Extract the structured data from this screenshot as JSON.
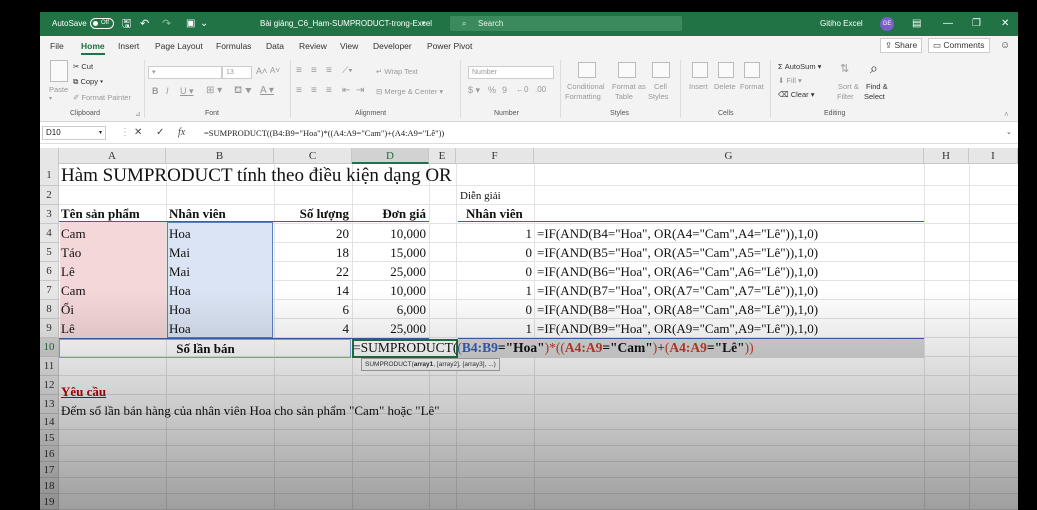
{
  "titlebar": {
    "autosave_label": "AutoSave",
    "autosave_state": "Off",
    "doc_title": "Bài giảng_C6_Ham-SUMPRODUCT-trong-Excel",
    "search_placeholder": "Search",
    "user_name": "Gitiho Excel",
    "user_initials": "GE"
  },
  "tabs": [
    "File",
    "Home",
    "Insert",
    "Page Layout",
    "Formulas",
    "Data",
    "Review",
    "View",
    "Developer",
    "Power Pivot"
  ],
  "share_label": "Share",
  "comments_label": "Comments",
  "ribbon": {
    "clipboard": {
      "paste": "Paste",
      "cut": "Cut",
      "copy": "Copy",
      "format_painter": "Format Painter",
      "group": "Clipboard"
    },
    "font": {
      "size": "13",
      "group": "Font"
    },
    "alignment": {
      "wrap": "Wrap Text",
      "merge": "Merge & Center",
      "group": "Alignment"
    },
    "number": {
      "format": "Number",
      "group": "Number"
    },
    "styles": {
      "cond": "Conditional",
      "cond2": "Formatting",
      "fmt_table": "Format as",
      "fmt_table2": "Table",
      "cell_styles": "Cell",
      "cell_styles2": "Styles",
      "group": "Styles"
    },
    "cells": {
      "insert": "Insert",
      "delete": "Delete",
      "format": "Format",
      "group": "Cells"
    },
    "editing": {
      "autosum": "AutoSum",
      "fill": "Fill",
      "clear": "Clear",
      "sort": "Sort &",
      "sort2": "Filter",
      "find": "Find &",
      "find2": "Select",
      "group": "Editing"
    }
  },
  "formula_bar": {
    "name_box": "D10",
    "formula": "=SUMPRODUCT((B4:B9=\"Hoa\")*((A4:A9=\"Cam\")+(A4:A9=\"Lê\"))"
  },
  "columns": [
    "A",
    "B",
    "C",
    "D",
    "E",
    "F",
    "G",
    "H",
    "I"
  ],
  "rows": [
    "1",
    "2",
    "3",
    "4",
    "5",
    "6",
    "7",
    "8",
    "9",
    "10",
    "11",
    "12",
    "13",
    "14",
    "15",
    "16",
    "17",
    "18",
    "19"
  ],
  "sheet": {
    "title": "Hàm SUMPRODUCT tính theo điều kiện dạng OR",
    "headers": {
      "product": "Tên sản phẩm",
      "staff": "Nhân viên",
      "qty": "Số lượng",
      "price": "Đơn giá"
    },
    "table": [
      {
        "product": "Cam",
        "staff": "Hoa",
        "qty": "20",
        "price": "10,000"
      },
      {
        "product": "Táo",
        "staff": "Mai",
        "qty": "18",
        "price": "15,000"
      },
      {
        "product": "Lê",
        "staff": "Mai",
        "qty": "22",
        "price": "25,000"
      },
      {
        "product": "Cam",
        "staff": "Hoa",
        "qty": "14",
        "price": "10,000"
      },
      {
        "product": "Ổi",
        "staff": "Hoa",
        "qty": "6",
        "price": "6,000"
      },
      {
        "product": "Lê",
        "staff": "Hoa",
        "qty": "4",
        "price": "25,000"
      }
    ],
    "total_label": "Số lần bán",
    "explain_title": "Diễn giải",
    "explain_header": "Nhân viên",
    "explain": [
      {
        "value": "1",
        "formula": "=IF(AND(B4=\"Hoa\", OR(A4=\"Cam\",A4=\"Lê\")),1,0)"
      },
      {
        "value": "0",
        "formula": "=IF(AND(B5=\"Hoa\", OR(A5=\"Cam\",A5=\"Lê\")),1,0)"
      },
      {
        "value": "0",
        "formula": "=IF(AND(B6=\"Hoa\", OR(A6=\"Cam\",A6=\"Lê\")),1,0)"
      },
      {
        "value": "1",
        "formula": "=IF(AND(B7=\"Hoa\", OR(A7=\"Cam\",A7=\"Lê\")),1,0)"
      },
      {
        "value": "0",
        "formula": "=IF(AND(B8=\"Hoa\", OR(A8=\"Cam\",A8=\"Lê\")),1,0)"
      },
      {
        "value": "1",
        "formula": "=IF(AND(B9=\"Hoa\", OR(A9=\"Cam\",A9=\"Lê\")),1,0)"
      }
    ],
    "editing": {
      "p1": "=SUMPRODUCT(",
      "p2": "(",
      "p3": "B4:B9",
      "p4": "=\"Hoa\"",
      "p5": ")*(",
      "p6": "(",
      "p7": "A4:A9",
      "p8": "=\"Cam\"",
      "p9": ")",
      "p10": "+",
      "p11": "(",
      "p12": "A4:A9",
      "p13": "=\"Lê\"",
      "p14": "))"
    },
    "hint": {
      "fn": "SUMPRODUCT(",
      "arg1": "array1",
      "rest": ", [array2], [array3], ...)"
    },
    "req_label": "Yêu cầu",
    "req_text": "Đếm số lần bán hàng của nhân viên Hoa cho sản phẩm \"Cam\" hoặc \"Lê\""
  },
  "colors": {
    "excel_green": "#217346",
    "blue_ref": "#2f5fb3",
    "red_ref": "#c0392b",
    "req_red": "#c00000"
  }
}
